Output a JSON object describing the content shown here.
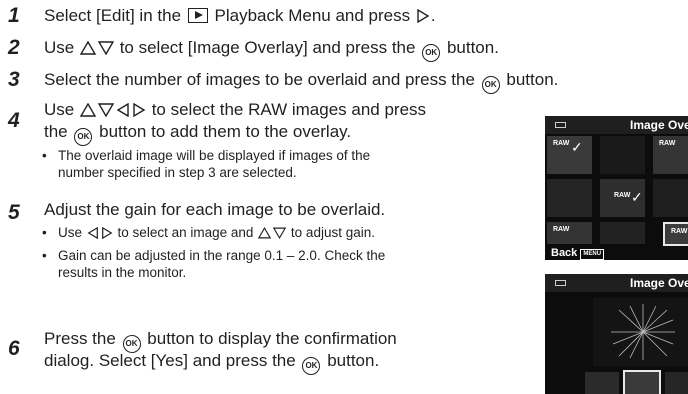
{
  "steps": [
    {
      "num": "1",
      "a": "Select [Edit] in the",
      "b": "Playback Menu and press",
      "c": "."
    },
    {
      "num": "2",
      "a": "Use",
      "b": "to select [Image Overlay] and press the",
      "c": "button."
    },
    {
      "num": "3",
      "a": "Select the number of images to be overlaid and press the",
      "b": "button."
    },
    {
      "num": "4",
      "line1a": "Use",
      "line1b": "to select the RAW images and press",
      "line2a": "the",
      "line2b": "button to add them to the overlay.",
      "bullet1": "The overlaid image will be displayed if images of the",
      "bullet1b": "number specified in step 3 are selected."
    },
    {
      "num": "5",
      "line1": "Adjust the gain for each image to be overlaid.",
      "bullet1a": "Use",
      "bullet1b": "to select an image and",
      "bullet1c": "to adjust gain.",
      "bullet2": "Gain can be adjusted in the range 0.1 – 2.0. Check the",
      "bullet2b": "results in the monitor."
    },
    {
      "num": "6",
      "line1a": "Press the",
      "line1b": "button to display the confirmation",
      "line2a": "dialog. Select [Yes] and press the",
      "line2b": "button."
    }
  ],
  "bullet_char": "•",
  "ok_label": "OK",
  "screen1": {
    "title": "Image Over",
    "raw_label": "RAW",
    "check": "✓",
    "back": "Back",
    "menu_key": "MENU"
  },
  "screen2": {
    "title": "Image Over"
  }
}
